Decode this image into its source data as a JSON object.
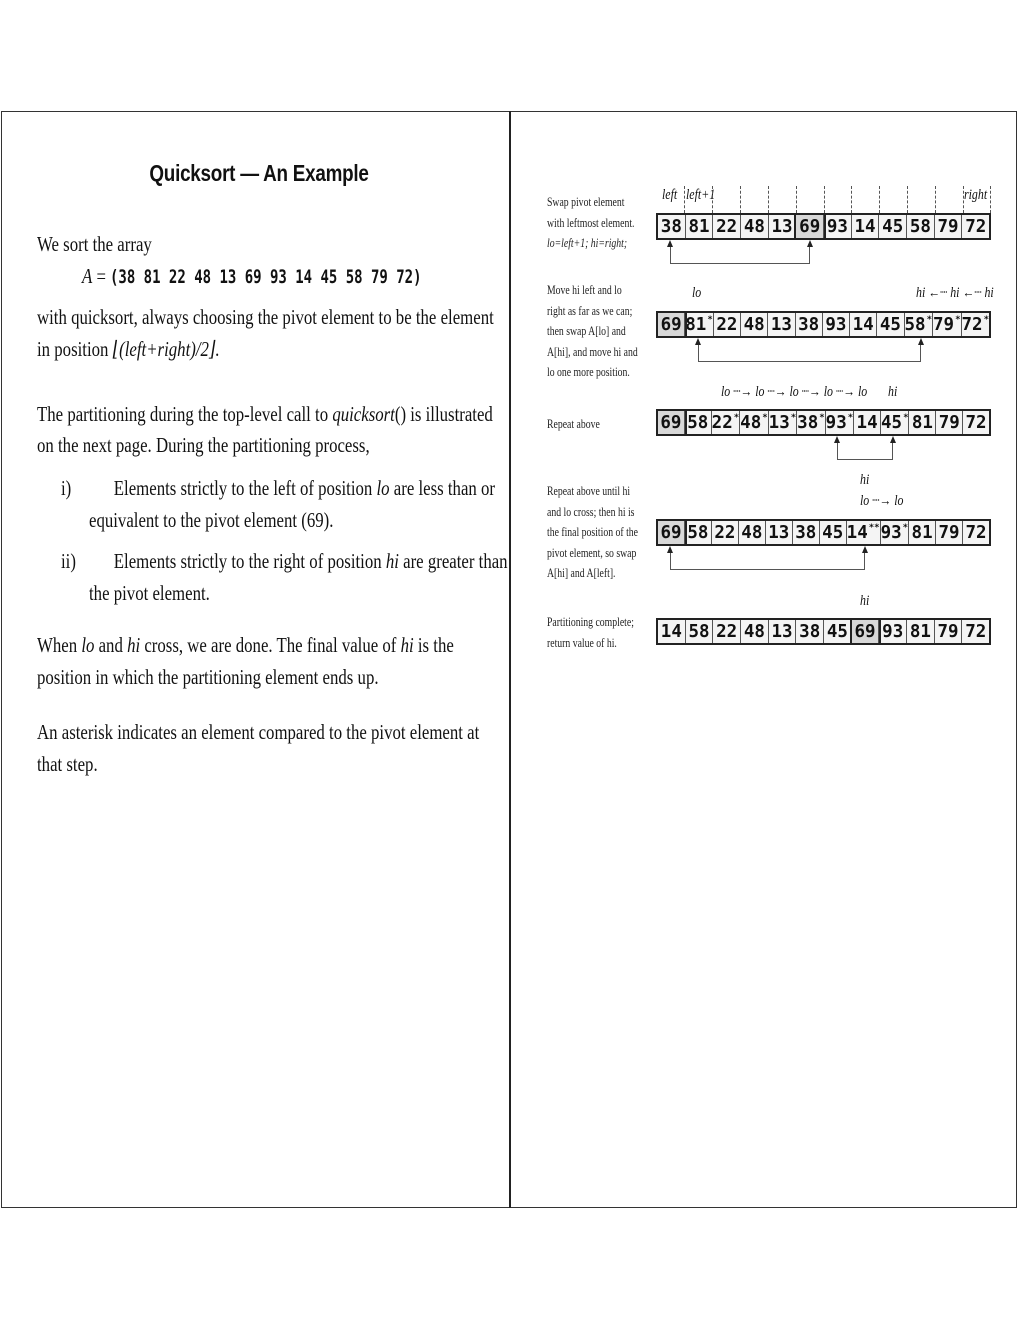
{
  "left_page": {
    "title": "Quicksort — An Example",
    "intro": "We sort the array",
    "array_label": "A",
    "array_eq": " = ",
    "array_values": "(38 81 22 48 13 69 93 14 45 58 79 72)",
    "para1_line1": "with quicksort, always choosing the pivot element to be the element",
    "para1_line2_pre": "in position ",
    "para1_line2_formula": "⌊(left+right)/2⌋.",
    "para2_line1_pre": "The partitioning during the top-level call to ",
    "para2_line1_fn": "quicksort",
    "para2_line1_post": "() is illustrated",
    "para2_line2": "on the next page.  During the partitioning process,",
    "list": [
      {
        "num": "i)",
        "line1_pre": "Elements strictly to the left of position ",
        "var": "lo",
        "line1_post": " are less than or",
        "line2": "equivalent to the pivot element (69)."
      },
      {
        "num": "ii)",
        "line1_pre": "Elements strictly to the right of position ",
        "var": "hi",
        "line1_post": " are greater than",
        "line2": "the pivot element."
      }
    ],
    "para3_line1": [
      "When ",
      "lo",
      " and ",
      "hi",
      " cross, we are done.  The final value of ",
      "hi",
      " is the"
    ],
    "para3_line2": "position in which the partitioning element ends up.",
    "para4_line1": "An asterisk indicates an element compared to the pivot element at",
    "para4_line2": "that step."
  },
  "right_page": {
    "steps": [
      {
        "desc": [
          "Swap pivot element",
          "with leftmost element.",
          "lo=left+1; hi=right;"
        ],
        "labels": {
          "left": "left",
          "left1": "left+1",
          "right": "right"
        },
        "cells": [
          "38",
          "81",
          "22",
          "48",
          "13",
          "69",
          "93",
          "14",
          "45",
          "58",
          "79",
          "72"
        ],
        "marks": [
          "",
          "",
          "",
          "",
          "",
          "",
          "",
          "",
          "",
          "",
          "",
          ""
        ],
        "pivot_index": 5,
        "swap": [
          0,
          5
        ]
      },
      {
        "desc": [
          "Move hi left and lo",
          "right as far as we can;",
          "then swap A[lo] and",
          "A[hi], and move hi and",
          "lo one more position."
        ],
        "labels": {
          "lo": "lo",
          "hi_seq": "hi ←┈ hi ←┈ hi"
        },
        "cells": [
          "69",
          "81",
          "22",
          "48",
          "13",
          "38",
          "93",
          "14",
          "45",
          "58",
          "79",
          "72"
        ],
        "marks": [
          "",
          "*",
          "",
          "",
          "",
          "",
          "",
          "",
          "",
          "*",
          "*",
          "*"
        ],
        "pivot_index": 0,
        "swap": [
          1,
          9
        ]
      },
      {
        "desc": [
          "Repeat above"
        ],
        "labels": {
          "lo_seq": "lo ┈→ lo ┈→ lo ┈→ lo ┈→ lo",
          "hi": "hi"
        },
        "cells": [
          "69",
          "58",
          "22",
          "48",
          "13",
          "38",
          "93",
          "14",
          "45",
          "81",
          "79",
          "72"
        ],
        "marks": [
          "",
          "",
          "*",
          "*",
          "*",
          "*",
          "*",
          "",
          "*",
          "",
          "",
          ""
        ],
        "pivot_index": 0,
        "swap": [
          6,
          8
        ]
      },
      {
        "desc": [
          "Repeat above until hi",
          "and lo cross; then hi is",
          "the final position of the",
          "pivot element, so swap",
          "A[hi] and A[left]."
        ],
        "labels": {
          "hi": "hi",
          "lo_seq": "lo ┈→ lo"
        },
        "cells": [
          "69",
          "58",
          "22",
          "48",
          "13",
          "38",
          "45",
          "14",
          "93",
          "81",
          "79",
          "72"
        ],
        "marks": [
          "",
          "",
          "",
          "",
          "",
          "",
          "",
          "**",
          "*",
          "",
          "",
          ""
        ],
        "pivot_index": 0,
        "swap": [
          0,
          7
        ]
      },
      {
        "desc": [
          "Partitioning complete;",
          "return value of hi."
        ],
        "labels": {
          "hi": "hi"
        },
        "cells": [
          "14",
          "58",
          "22",
          "48",
          "13",
          "38",
          "45",
          "69",
          "93",
          "81",
          "79",
          "72"
        ],
        "marks": [
          "",
          "",
          "",
          "",
          "",
          "",
          "",
          "",
          "",
          "",
          "",
          ""
        ],
        "pivot_index": 7,
        "swap": null
      }
    ]
  }
}
